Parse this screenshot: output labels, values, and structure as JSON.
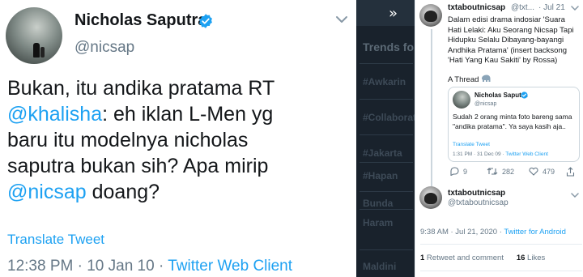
{
  "left_tweet": {
    "name": "Nicholas Saputra",
    "handle": "@nicsap",
    "text_line1": "Bukan, itu andika pratama RT",
    "mention1": "@khalisha",
    "text_line2_rest": ": eh  iklan L-Men yg",
    "text_line3": "baru itu modelnya nicholas",
    "text_line4": "saputra bukan sih? Apa mirip",
    "mention2": "@nicsap",
    "text_line5_rest": " doang?",
    "translate_label": "Translate Tweet",
    "time": "12:38 PM · 10 Jan 10 · ",
    "source": "Twitter Web Client"
  },
  "strip": {
    "heading": "Trends for",
    "words": [
      "#Awkarin",
      "#Collaborat",
      "#Jakarta",
      "#Hapan",
      "Bunda",
      "Haram",
      "Maldini"
    ]
  },
  "right_thread": {
    "user_name": "txtaboutnicsap",
    "user_handle_short": "@txt...",
    "date": "· Jul 21",
    "text": "Dalam edisi drama indosiar 'Suara Hati Lelaki: Aku Seorang Nicsap Tapi Hidupku Selalu Dibayang-bayangi Andhika Pratama' (insert backsong 'Hati Yang Kau Sakiti' by Rossa)",
    "a_thread": "A Thread",
    "quote": {
      "name": "Nicholas Saputra",
      "handle": "@nicsap",
      "text": "Sudah 2 orang minta foto bareng sama \"andika pratama\". Ya saya kasih aja..",
      "translate_label": "Translate Tweet",
      "time": "1:31 PM · 31 Dec 09 · ",
      "source": "Twitter Web Client"
    },
    "actions": {
      "replies": "9",
      "retweets": "282",
      "likes": "479"
    },
    "second_tweet": {
      "user_name": "txtaboutnicsap",
      "user_handle": "@txtaboutnicsap",
      "time": "9:38 AM · Jul 21, 2020 · ",
      "source": "Twitter for Android",
      "retweets_count": "1",
      "retweets_label": " Retweet and comment",
      "likes_count": "16",
      "likes_label": " Likes"
    }
  },
  "colors": {
    "link": "#1da1f2",
    "grey": "#657786",
    "text": "#14171a",
    "dark": "#19222c"
  },
  "icons": [
    "verified-badge-icon",
    "chevron-down-icon",
    "fold-arrow-icon",
    "reply-icon",
    "retweet-icon",
    "like-icon",
    "share-icon",
    "elephant-emoji-icon"
  ]
}
